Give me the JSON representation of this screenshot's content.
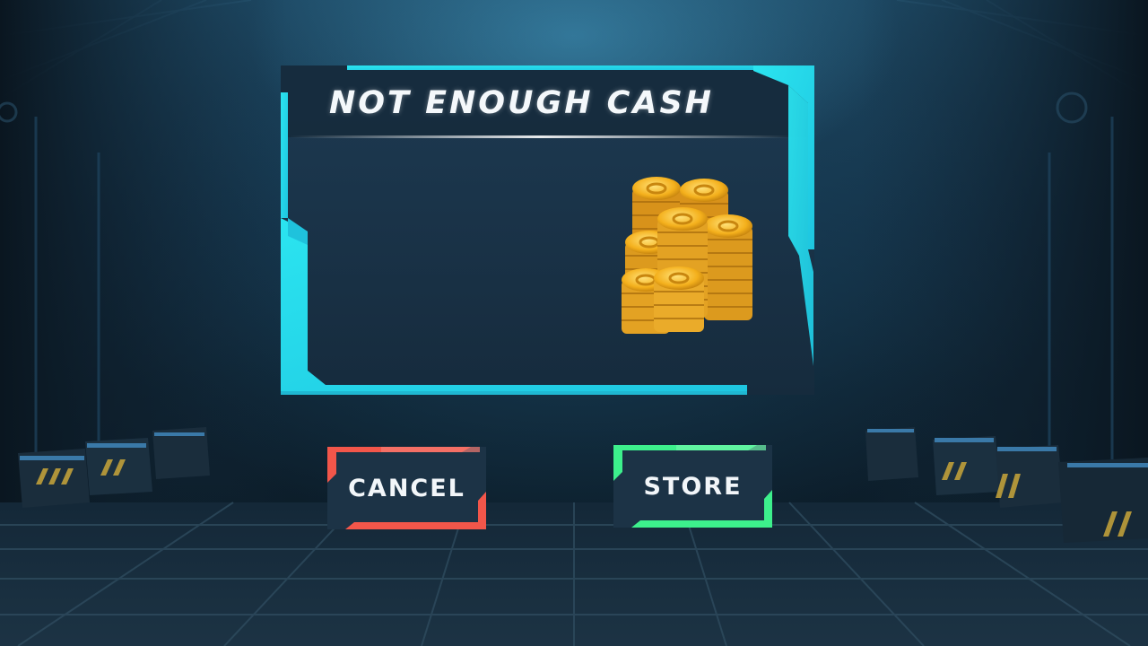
{
  "dialog": {
    "title": "NOT ENOUGH CASH",
    "image_icon": "coin-stack-icon"
  },
  "buttons": {
    "cancel_label": "CANCEL",
    "store_label": "STORE"
  },
  "colors": {
    "frame_accent": "#29e6f2",
    "cancel_accent": "#f2564a",
    "store_accent": "#3df08c",
    "coin_gold": "#f4b01c",
    "panel_bg": "#182f44"
  }
}
